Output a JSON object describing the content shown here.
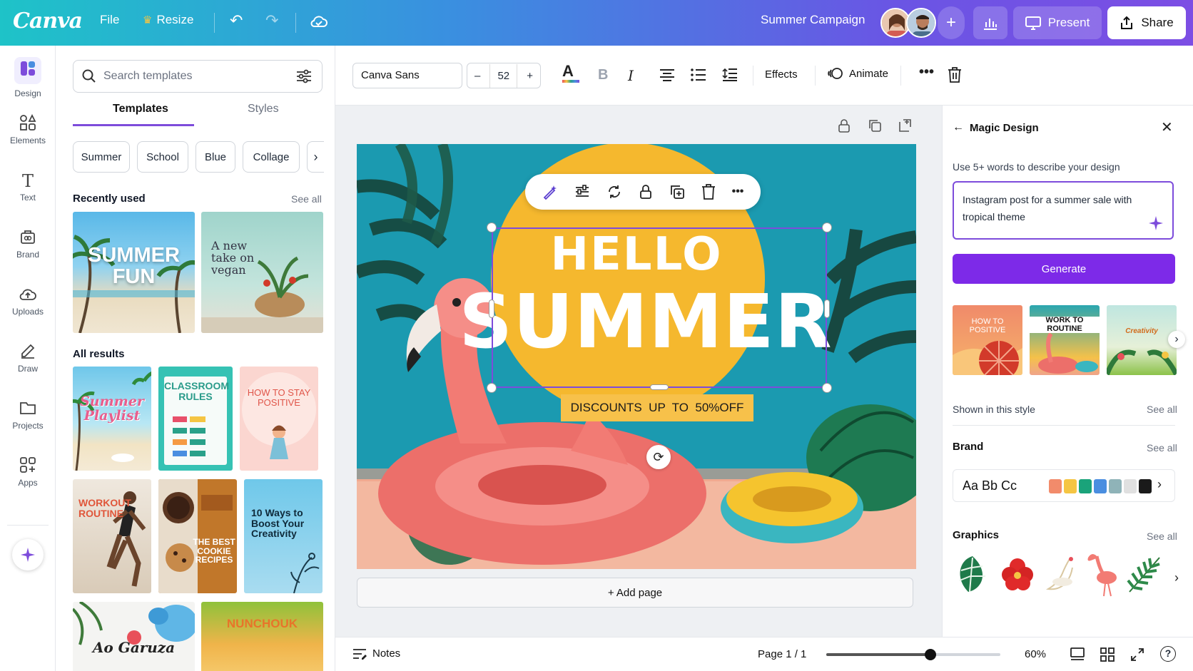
{
  "app": {
    "logo": "Canva",
    "project_title": "Summer Campaign"
  },
  "topbar": {
    "file": "File",
    "resize": "Resize",
    "present": "Present",
    "share": "Share"
  },
  "rail": [
    {
      "label": "Design",
      "icon": "design-icon"
    },
    {
      "label": "Elements",
      "icon": "elements-icon"
    },
    {
      "label": "Text",
      "icon": "text-icon"
    },
    {
      "label": "Brand",
      "icon": "brand-icon"
    },
    {
      "label": "Uploads",
      "icon": "uploads-icon"
    },
    {
      "label": "Draw",
      "icon": "draw-icon"
    },
    {
      "label": "Projects",
      "icon": "projects-icon"
    },
    {
      "label": "Apps",
      "icon": "apps-icon"
    }
  ],
  "panel": {
    "search_placeholder": "Search templates",
    "tabs": [
      "Templates",
      "Styles"
    ],
    "chips": [
      "Summer",
      "School",
      "Blue",
      "Collage"
    ],
    "recently_used": "Recently used",
    "see_all": "See all",
    "all_results": "All results",
    "recent": [
      {
        "text": "SUMMER FUN"
      },
      {
        "text": "A new take on vegan"
      }
    ],
    "results": [
      {
        "text": "Summer Playlist"
      },
      {
        "text": "CLASSROOM RULES"
      },
      {
        "text": "HOW TO STAY POSITIVE"
      },
      {
        "text": "WORKOUT ROUTINE"
      },
      {
        "text": "THE BEST COOKIE RECIPES"
      },
      {
        "text": "10 Ways to Boost Your Creativity"
      },
      {
        "text": "Ao Garuza"
      },
      {
        "text": "NUNCHOUK"
      }
    ]
  },
  "toolbar": {
    "font": "Canva Sans",
    "size": "52",
    "minus": "–",
    "plus": "+",
    "effects": "Effects",
    "animate": "Animate"
  },
  "canvas": {
    "hello": "HELLO",
    "summer": "SUMMER",
    "discount": "DISCOUNTS  UP  TO  50%OFF"
  },
  "add_page": "+ Add page",
  "magic": {
    "title": "Magic Design",
    "prompt_label": "Use 5+ words to describe your design",
    "prompt_value": "Instagram post for a summer sale with tropical theme",
    "generate": "Generate",
    "results": [
      {
        "text": "HOW TO POSITIVE"
      },
      {
        "text": "WORK TO ROUTINE"
      },
      {
        "text": "Creativity"
      }
    ],
    "shown_style": "Shown in this style",
    "brand": "Brand",
    "brand_sample": "Aa Bb Cc",
    "graphics": "Graphics",
    "see_all": "See all",
    "brand_colors": [
      "#f28b6b",
      "#f5c543",
      "#1aa37a",
      "#4a8ee0",
      "#8fb3b8",
      "#e0e0e0",
      "#1a1a1a"
    ]
  },
  "bottombar": {
    "notes": "Notes",
    "page": "Page 1 / 1",
    "zoom": "60%",
    "zoom_fraction": 0.6
  }
}
